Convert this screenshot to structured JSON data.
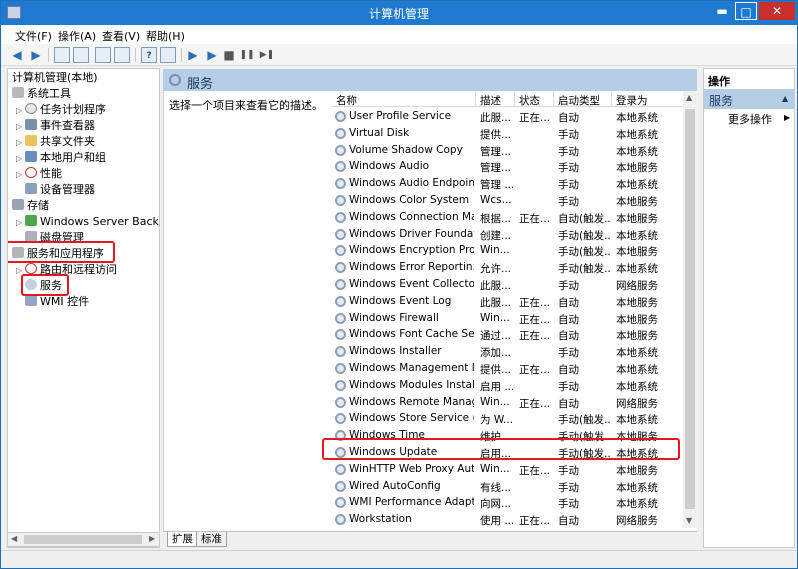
{
  "window": {
    "title": "计算机管理",
    "min": "▬",
    "max": "□",
    "close": "✕"
  },
  "menu": [
    "文件(F)",
    "操作(A)",
    "查看(V)",
    "帮助(H)"
  ],
  "toolbar": {
    "back": "◀",
    "forward": "▶",
    "help": "?",
    "play": "▶",
    "stop": "■",
    "pause": "❚❚",
    "restart": "▶❚"
  },
  "tree": {
    "root": "计算机管理(本地)",
    "system_tools": "系统工具",
    "task_scheduler": "任务计划程序",
    "event_viewer": "事件查看器",
    "shared_folders": "共享文件夹",
    "local_users": "本地用户和组",
    "performance": "性能",
    "device_manager": "设备管理器",
    "storage": "存储",
    "windows_server_backup": "Windows Server Backup",
    "disk_management": "磁盘管理",
    "services_apps": "服务和应用程序",
    "routing": "路由和远程访问",
    "services": "服务",
    "wmi": "WMI 控件"
  },
  "main": {
    "header": "服务",
    "description": "选择一个项目来查看它的描述。",
    "columns": [
      "名称",
      "描述",
      "状态",
      "启动类型",
      "登录为"
    ],
    "rows": [
      [
        "User Profile Service",
        "此服...",
        "正在...",
        "自动",
        "本地系统"
      ],
      [
        "Virtual Disk",
        "提供...",
        "",
        "手动",
        "本地系统"
      ],
      [
        "Volume Shadow Copy",
        "管理...",
        "",
        "手动",
        "本地系统"
      ],
      [
        "Windows Audio",
        "管理...",
        "",
        "手动",
        "本地服务"
      ],
      [
        "Windows Audio Endpoint...",
        "管理 ...",
        "",
        "手动",
        "本地系统"
      ],
      [
        "Windows Color System",
        "Wcs...",
        "",
        "手动",
        "本地服务"
      ],
      [
        "Windows Connection Ma...",
        "根据...",
        "正在...",
        "自动(触发...",
        "本地服务"
      ],
      [
        "Windows Driver Foundati...",
        "创建...",
        "",
        "手动(触发...",
        "本地系统"
      ],
      [
        "Windows Encryption Pro...",
        "Win...",
        "",
        "手动(触发...",
        "本地服务"
      ],
      [
        "Windows Error Reportin...",
        "允许...",
        "",
        "手动(触发...",
        "本地系统"
      ],
      [
        "Windows Event Collector",
        "此服...",
        "",
        "手动",
        "网络服务"
      ],
      [
        "Windows Event Log",
        "此服...",
        "正在...",
        "自动",
        "本地服务"
      ],
      [
        "Windows Firewall",
        "Win...",
        "正在...",
        "自动",
        "本地服务"
      ],
      [
        "Windows Font Cache Ser...",
        "通过...",
        "正在...",
        "自动",
        "本地服务"
      ],
      [
        "Windows Installer",
        "添加...",
        "",
        "手动",
        "本地系统"
      ],
      [
        "Windows Management I...",
        "提供...",
        "正在...",
        "自动",
        "本地系统"
      ],
      [
        "Windows Modules Install...",
        "启用 ...",
        "",
        "手动",
        "本地系统"
      ],
      [
        "Windows Remote Manag...",
        "Win...",
        "正在...",
        "自动",
        "网络服务"
      ],
      [
        "Windows Store Service (...",
        "为 W...",
        "",
        "手动(触发...",
        "本地系统"
      ],
      [
        "Windows Time",
        "维护...",
        "",
        "手动(触发...",
        "本地服务"
      ],
      [
        "Windows Update",
        "启用...",
        "",
        "手动(触发...",
        "本地系统"
      ],
      [
        "WinHTTP Web Proxy Aut...",
        "Win...",
        "正在...",
        "手动",
        "本地服务"
      ],
      [
        "Wired AutoConfig",
        "有线...",
        "",
        "手动",
        "本地系统"
      ],
      [
        "WMI Performance Adapt...",
        "向网...",
        "",
        "手动",
        "本地系统"
      ],
      [
        "Workstation",
        "使用 ...",
        "正在...",
        "自动",
        "网络服务"
      ]
    ],
    "tabs": [
      "扩展",
      "标准"
    ]
  },
  "actions": {
    "title": "操作",
    "section": "服务",
    "more": "更多操作",
    "more_arrow": "▶",
    "collapse": "▲"
  }
}
